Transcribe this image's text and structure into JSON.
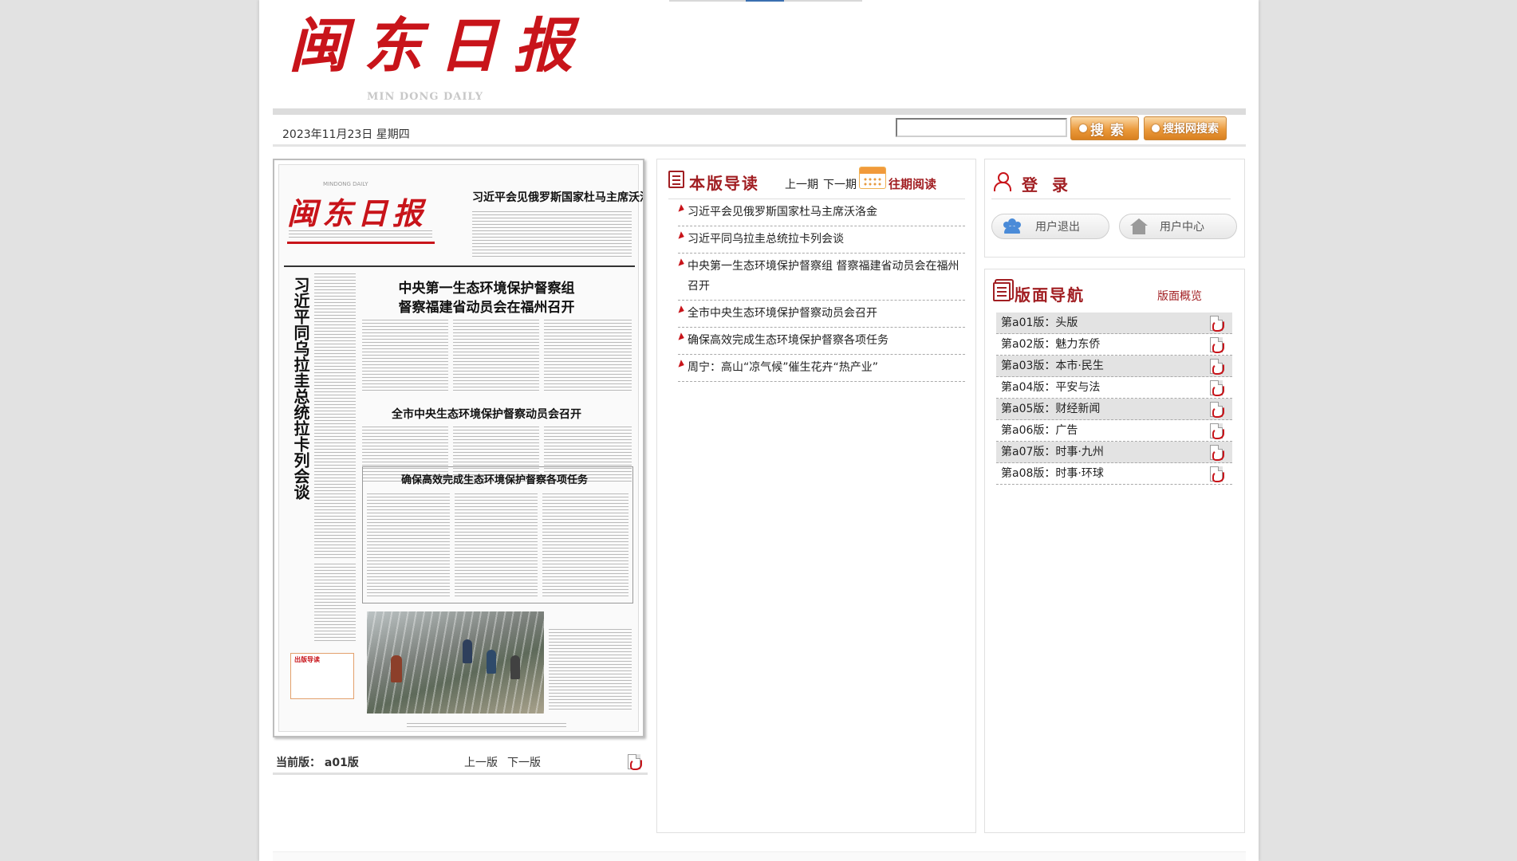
{
  "header": {
    "logo_cn": "闽东日报",
    "logo_en": "MIN DONG DAILY",
    "date": "2023年11月23日 星期四",
    "search_placeholder": "",
    "search_button": "搜索",
    "net_search_button": "搜报网搜索"
  },
  "paper_preview": {
    "masthead": "闽东日报",
    "masthead_sub": "MINDONG DAILY",
    "top_headline": "习近平会见俄罗斯国家杜马主席沃洛金",
    "vertical_headline": "习近平同乌拉圭总统拉卡列会谈",
    "headline_1a": "中央第一生态环境保护督察组",
    "headline_1b": "督察福建省动员会在福州召开",
    "headline_2": "全市中央生态环境保护督察动员会召开",
    "headline_3": "确保高效完成生态环境保护督察各项任务",
    "sidebox_label": "出版导读"
  },
  "current_edition": {
    "label": "当前版：",
    "edition": "a01版",
    "prev": "上一版",
    "next": "下一版"
  },
  "guide": {
    "title": "本版导读",
    "prev": "上一期",
    "next": "下一期",
    "past": "往期阅读",
    "articles": [
      "习近平会见俄罗斯国家杜马主席沃洛金",
      "习近平同乌拉圭总统拉卡列会谈",
      "中央第一生态环境保护督察组 督察福建省动员会在福州召开",
      "全市中央生态环境保护督察动员会召开",
      "确保高效完成生态环境保护督察各项任务",
      "周宁：高山“凉气候”催生花卉“热产业”"
    ]
  },
  "login": {
    "title": "登录",
    "logout": "用户退出",
    "user_center": "用户中心"
  },
  "page_nav": {
    "title": "版面导航",
    "overview": "版面概览",
    "pages": [
      "第a01版：头版",
      "第a02版：魅力东侨",
      "第a03版：本市·民生",
      "第a04版：平安与法",
      "第a05版：财经新闻",
      "第a06版：广告",
      "第a07版：时事·九州",
      "第a08版：时事·环球"
    ]
  },
  "colors": {
    "brand_red": "#c8141a",
    "title_red": "#a11e22",
    "button_orange": "#eb9a3c"
  }
}
